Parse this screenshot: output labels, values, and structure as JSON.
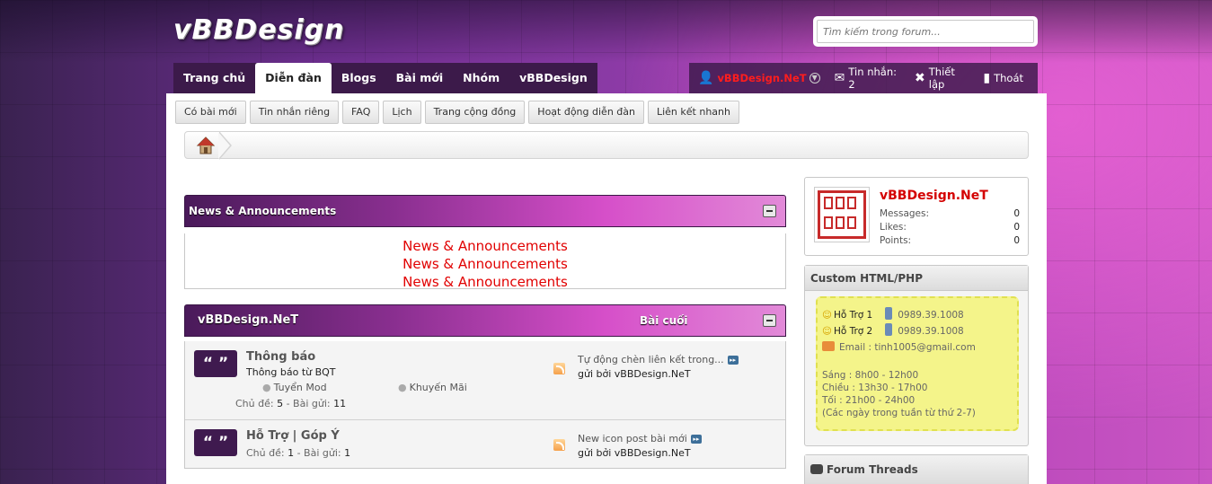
{
  "header": {
    "logo_text": "vBBDesign",
    "search_placeholder": "Tìm kiếm trong forum..."
  },
  "nav": {
    "tabs": [
      {
        "label": "Trang chủ"
      },
      {
        "label": "Diễn đàn",
        "active": true
      },
      {
        "label": "Blogs"
      },
      {
        "label": "Bài mới"
      },
      {
        "label": "Nhóm"
      },
      {
        "label": "vBBDesign"
      }
    ]
  },
  "userbar": {
    "username": "vBBDesign.NeT",
    "messages_label": "Tin nhắn: 2",
    "settings_label": "Thiết lập",
    "logout_label": "Thoát"
  },
  "subnav": {
    "buttons": [
      "Có bài mới",
      "Tin nhắn riêng",
      "FAQ",
      "Lịch",
      "Trang cộng đồng",
      "Hoạt động diễn đàn",
      "Liên kết nhanh"
    ]
  },
  "news": {
    "header_title": "News & Announcements",
    "lines": [
      "News & Announcements",
      "News & Announcements",
      "News & Announcements"
    ]
  },
  "forum_category": {
    "title": "vBBDesign.NeT",
    "last_post_label": "Bài cuối",
    "forums": [
      {
        "title": "Thông báo",
        "description": "Thông báo từ BQT",
        "subforums": [
          "Tuyển Mod",
          "Khuyến Mãi"
        ],
        "stats_topics_label": "Chủ đề:",
        "topics": "5",
        "stats_posts_label": "Bài gửi:",
        "posts": "11",
        "last_post_title": "Tự động chèn liên kết trong...",
        "last_post_by_prefix": "gửi bởi",
        "last_post_by": "vBBDesign.NeT"
      },
      {
        "title": "Hỗ Trợ | Góp Ý",
        "stats_topics_label": "Chủ đề:",
        "topics": "1",
        "stats_posts_label": "Bài gửi:",
        "posts": "1",
        "last_post_title": "New icon post bài mới",
        "last_post_by_prefix": "gửi bởi",
        "last_post_by": "vBBDesign.NeT"
      }
    ]
  },
  "sidebar": {
    "user_card": {
      "name": "vBBDesign.NeT",
      "stats": [
        {
          "label": "Messages:",
          "value": "0"
        },
        {
          "label": "Likes:",
          "value": "0"
        },
        {
          "label": "Points:",
          "value": "0"
        }
      ]
    },
    "custom_block": {
      "title": "Custom HTML/PHP",
      "support": [
        {
          "name": "Hỗ Trợ 1",
          "phone": "0989.39.1008"
        },
        {
          "name": "Hỗ Trợ 2",
          "phone": "0989.39.1008"
        }
      ],
      "email": "Email : tinh1005@gmail.com",
      "hours": [
        "Sáng : 8h00 - 12h00",
        "Chiều : 13h30 - 17h00",
        "Tối : 21h00 - 24h00",
        "(Các ngày trong tuần từ thứ 2-7)"
      ]
    },
    "forum_threads_title": "Forum Threads"
  },
  "colors": {
    "accent_purple": "#3c1a4a",
    "link_red": "#e10000",
    "note_yellow": "#f4f48a"
  }
}
